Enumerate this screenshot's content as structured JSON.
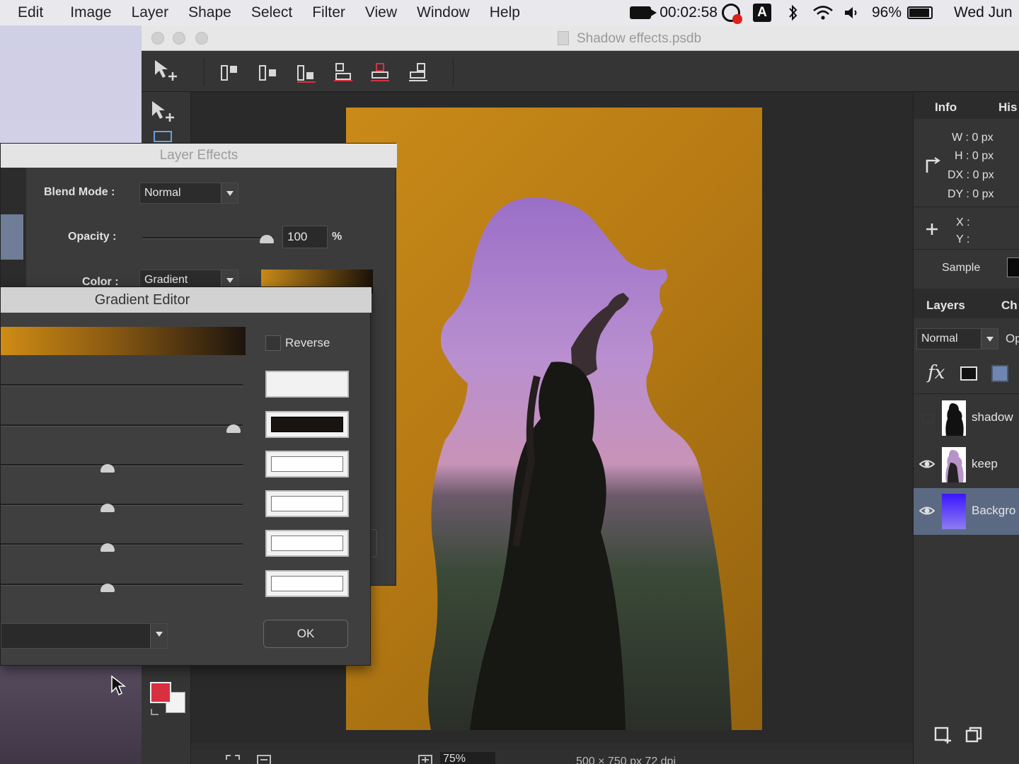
{
  "menubar": {
    "items": [
      "Edit",
      "Image",
      "Layer",
      "Shape",
      "Select",
      "Filter",
      "View",
      "Window",
      "Help"
    ],
    "timer": "00:02:58",
    "battery": "96%",
    "date": "Wed Jun",
    "input_key": "A"
  },
  "window": {
    "title": "Shadow effects.psdb"
  },
  "options": {
    "auto_selection": "Auto Selection",
    "auto_alignment": "Auto Alignment"
  },
  "info_panel": {
    "tab_info": "Info",
    "tab_history": "His",
    "w": "W :  0 px",
    "h": "H :  0 px",
    "dx": "DX :  0 px",
    "dy": "DY :  0 px",
    "x": "X :",
    "y": "Y :",
    "sample": "Sample"
  },
  "layers_panel": {
    "tab_layers": "Layers",
    "tab_channels": "Ch",
    "blend": "Normal",
    "opacity_label": "Op",
    "fx": "fx",
    "layers": [
      {
        "name": "shadow",
        "visible": false
      },
      {
        "name": "keep",
        "visible": true
      },
      {
        "name": "Backgro",
        "visible": true
      }
    ]
  },
  "layer_effects": {
    "title": "Layer Effects",
    "blend_mode_label": "Blend Mode :",
    "blend_mode_value": "Normal",
    "opacity_label": "Opacity :",
    "opacity_value": "100",
    "opacity_unit": "%",
    "color_label": "Color :",
    "color_value": "Gradient"
  },
  "gradient_editor": {
    "title": "Gradient Editor",
    "reverse_label": "Reverse",
    "ok_label": "OK",
    "stop_colors": [
      "#f2f2f2",
      "#1a1410",
      "#ffffff",
      "#ffffff",
      "#ffffff",
      "#ffffff"
    ]
  },
  "status": {
    "zoom": "75%",
    "doc_info": "500 × 750 px  72 dpi"
  },
  "colors": {
    "foreground": "#d9303f",
    "background": "#f2f2f2",
    "artwork": "#c08318"
  }
}
